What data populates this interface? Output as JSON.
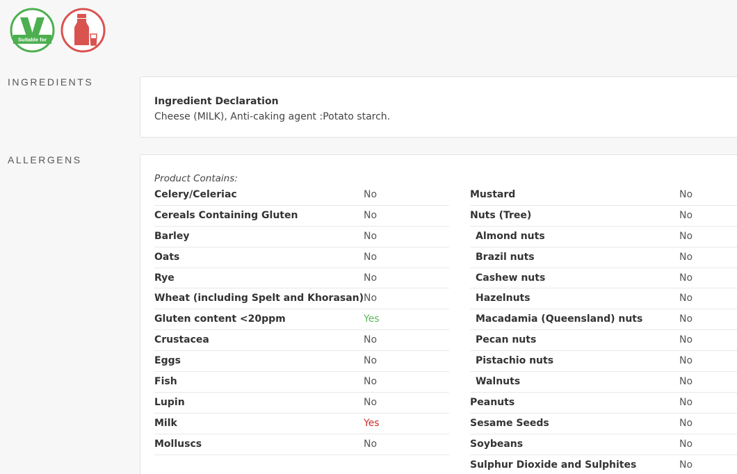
{
  "badges": {
    "veg_text": "Suitable for",
    "veg_color": "#4caf50",
    "milk_color": "#d9534f"
  },
  "sections": {
    "ingredients_label": "INGREDIENTS",
    "allergens_label": "ALLERGENS"
  },
  "ingredients": {
    "title": "Ingredient Declaration",
    "text": "Cheese (MILK), Anti-caking agent :Potato starch."
  },
  "allergens": {
    "contains_label": "Product Contains:",
    "left": [
      {
        "name": "Celery/Celeriac",
        "value": "No"
      },
      {
        "name": "Cereals Containing Gluten",
        "value": "No"
      },
      {
        "name": "Barley",
        "value": "No"
      },
      {
        "name": "Oats",
        "value": "No"
      },
      {
        "name": "Rye",
        "value": "No"
      },
      {
        "name": "Wheat (including Spelt and Khorasan)",
        "value": "No"
      },
      {
        "name": "Gluten content <20ppm",
        "value": "Yes"
      },
      {
        "name": "Crustacea",
        "value": "No"
      },
      {
        "name": "Eggs",
        "value": "No"
      },
      {
        "name": "Fish",
        "value": "No"
      },
      {
        "name": "Lupin",
        "value": "No"
      },
      {
        "name": "Milk",
        "value": "Yes"
      },
      {
        "name": "Molluscs",
        "value": "No"
      }
    ],
    "right": [
      {
        "name": "Mustard",
        "value": "No"
      },
      {
        "name": "Nuts (Tree)",
        "value": "No"
      },
      {
        "name": "Almond nuts",
        "value": "No"
      },
      {
        "name": "Brazil nuts",
        "value": "No"
      },
      {
        "name": "Cashew nuts",
        "value": "No"
      },
      {
        "name": "Hazelnuts",
        "value": "No"
      },
      {
        "name": "Macadamia (Queensland) nuts",
        "value": "No"
      },
      {
        "name": "Pecan nuts",
        "value": "No"
      },
      {
        "name": "Pistachio nuts",
        "value": "No"
      },
      {
        "name": "Walnuts",
        "value": "No"
      },
      {
        "name": "Peanuts",
        "value": "No"
      },
      {
        "name": "Sesame Seeds",
        "value": "No"
      },
      {
        "name": "Soybeans",
        "value": "No"
      },
      {
        "name": "Sulphur Dioxide and Sulphites",
        "value": "No"
      }
    ]
  }
}
